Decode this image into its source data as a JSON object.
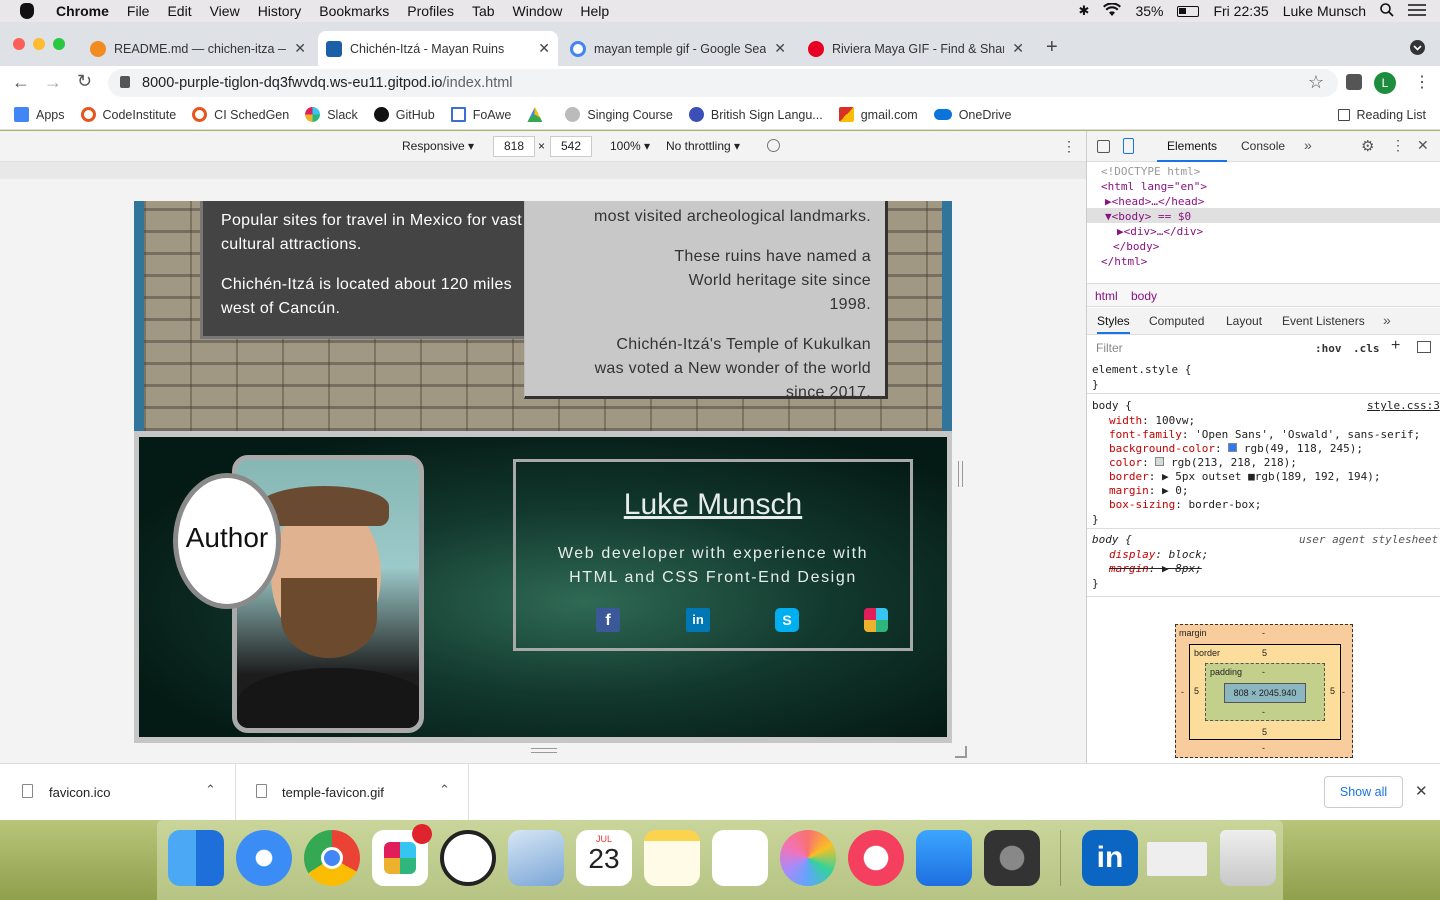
{
  "menubar": {
    "app": "Chrome",
    "items": [
      "File",
      "Edit",
      "View",
      "History",
      "Bookmarks",
      "Profiles",
      "Tab",
      "Window",
      "Help"
    ],
    "battery": "35%",
    "clock": "Fri 22:35",
    "user": "Luke Munsch"
  },
  "tabs": [
    {
      "title": "README.md — chichen-itza — ",
      "color": "#f28b22"
    },
    {
      "title": "Chichén-Itzá - Mayan Ruins",
      "color": "#1b5fa6"
    },
    {
      "title": "mayan temple gif - Google Sea",
      "color": "#4285f4"
    },
    {
      "title": "Riviera Maya GIF - Find & Share",
      "color": "#e60023"
    }
  ],
  "url": {
    "host": "8000-purple-tiglon-dq3fwvdq.ws-eu11.gitpod.io",
    "path": "/index.html"
  },
  "bookmarks": [
    {
      "label": "Apps",
      "color": "#4285f4"
    },
    {
      "label": "CodeInstitute",
      "color": "#e8541e"
    },
    {
      "label": "CI SchedGen",
      "color": "#e8541e"
    },
    {
      "label": "Slack",
      "color": "#e01e5a"
    },
    {
      "label": "GitHub",
      "color": "#111111"
    },
    {
      "label": "FoAwe",
      "color": "#3b6fd6"
    },
    {
      "label": "",
      "color": "#34a853"
    },
    {
      "label": "Singing Course",
      "color": "#888888"
    },
    {
      "label": "British Sign Langu...",
      "color": "#3b4fb6"
    },
    {
      "label": "gmail.com",
      "color": "#d93025"
    },
    {
      "label": "OneDrive",
      "color": "#0a74da"
    }
  ],
  "reading_list": "Reading List",
  "device_toolbar": {
    "mode": "Responsive ▾",
    "width": "818",
    "height": "542",
    "zoom": "100% ▾",
    "throttle": "No throttling ▾"
  },
  "site": {
    "facts_left": [
      "Popular sites for travel in Mexico for vast cultural attractions.",
      "Chichén-Itzá is located about 120 miles west of Cancún."
    ],
    "facts_right": [
      "most visited archeological landmarks.",
      "These ruins have named a World heritage site since 1998.",
      "Chichén-Itzá's Temple of Kukulkan was voted a New wonder of the world since 2017."
    ],
    "author_label": "Author",
    "author_name": "Luke Munsch",
    "author_bio": "Web developer with experience with HTML and CSS Front-End Design",
    "socials": [
      "facebook-icon",
      "linkedin-icon",
      "skype-icon",
      "slack-icon"
    ]
  },
  "devtools": {
    "tabs": [
      "Elements",
      "Console"
    ],
    "dom": [
      "<!DOCTYPE html>",
      "<html lang=\"en\">",
      "▶<head>…</head>",
      "▼<body> == $0",
      "▶<div>…</div>",
      "</body>",
      "</html>"
    ],
    "breadcrumbs": [
      "html",
      "body"
    ],
    "style_tabs": [
      "Styles",
      "Computed",
      "Layout",
      "Event Listeners"
    ],
    "filter_placeholder": "Filter",
    "hov": ":hov",
    "cls": ".cls",
    "element_style": "element.style {",
    "close_brace": "}",
    "body_rule_selector": "body {",
    "body_rule_source": "style.css:3",
    "body_rules": [
      {
        "prop": "width",
        "val": "100vw;"
      },
      {
        "prop": "font-family",
        "val": "'Open Sans', 'Oswald', sans-serif;"
      },
      {
        "prop": "background-color",
        "val": "rgb(49, 118, 245);"
      },
      {
        "prop": "color",
        "val": "rgb(213, 218, 218);"
      },
      {
        "prop": "border",
        "val": "▶ 5px outset ■rgb(189, 192, 194);"
      },
      {
        "prop": "margin",
        "val": "▶ 0;"
      },
      {
        "prop": "box-sizing",
        "val": "border-box;"
      }
    ],
    "ua_selector": "body {",
    "ua_source": "user agent stylesheet",
    "ua_rules": [
      {
        "prop": "display",
        "val": "block;"
      },
      {
        "prop": "margin",
        "val": "▶ 8px;"
      }
    ],
    "box_model": {
      "margin": "margin",
      "border": "border",
      "padding": "padding",
      "content": "808 × 2045.940",
      "dash": "-",
      "five": "5"
    }
  },
  "downloads": {
    "files": [
      "favicon.ico",
      "temple-favicon.gif"
    ],
    "show_all": "Show all"
  },
  "dock": {
    "calendar_month": "JUL",
    "calendar_day": "23"
  }
}
